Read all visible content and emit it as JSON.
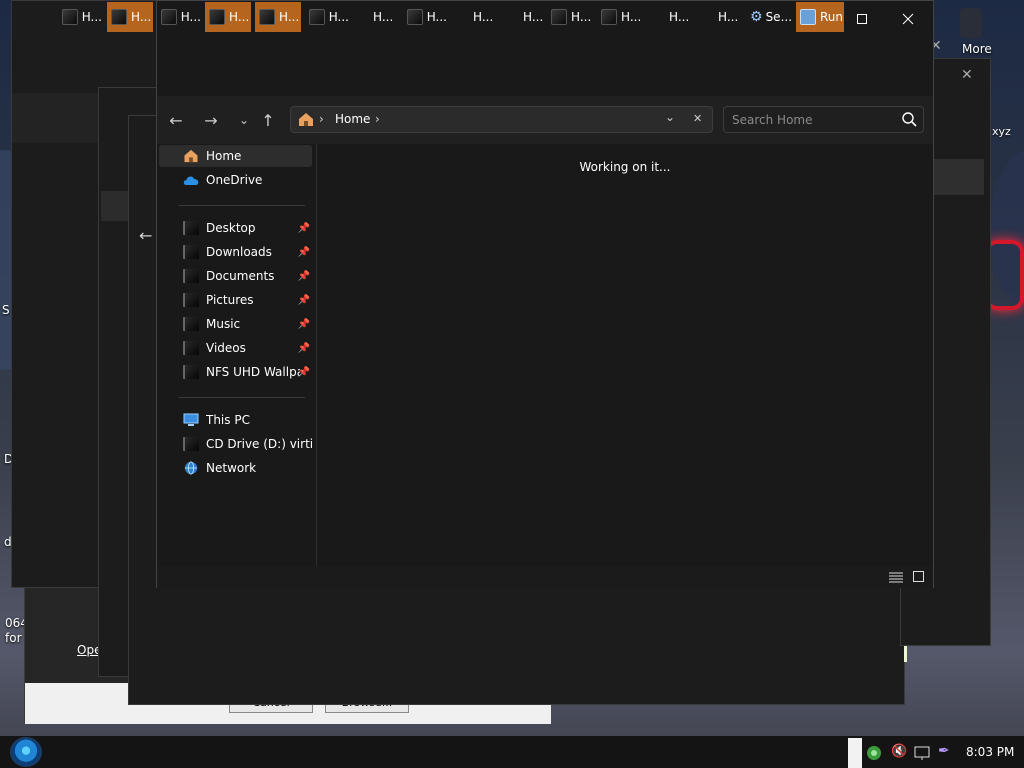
{
  "desktop": {
    "more_label": "More",
    "side_texts": [
      "S",
      "D",
      "d",
      "064",
      "for"
    ],
    "right_partial": "xyz",
    "partial_link": "Ope",
    "partial_button_1": "Cancel",
    "partial_button_2": "Browse..."
  },
  "explorer": {
    "address": {
      "home_label": "Home",
      "separator": "›",
      "trail": "›"
    },
    "search": {
      "placeholder": "Search Home"
    },
    "content": {
      "status_message": "Working on it..."
    },
    "sidebar": {
      "quick": [
        {
          "label": "Home",
          "selected": true
        },
        {
          "label": "OneDrive"
        }
      ],
      "pinned": [
        {
          "label": "Desktop"
        },
        {
          "label": "Downloads"
        },
        {
          "label": "Documents"
        },
        {
          "label": "Pictures"
        },
        {
          "label": "Music"
        },
        {
          "label": "Videos"
        },
        {
          "label": "NFS UHD Wallpap"
        }
      ],
      "devices": [
        {
          "label": "This PC"
        },
        {
          "label": "CD Drive (D:) virtio-w"
        },
        {
          "label": "Network"
        }
      ]
    }
  },
  "taskbar": {
    "items": [
      {
        "label": "H..."
      },
      {
        "label": "H...",
        "active": true
      },
      {
        "label": "H..."
      },
      {
        "label": "H...",
        "active": true
      },
      {
        "label": "H...",
        "active": true
      },
      {
        "label": "H..."
      },
      {
        "label": "H..."
      },
      {
        "label": "H..."
      },
      {
        "label": "H..."
      },
      {
        "label": "H..."
      },
      {
        "label": "H..."
      },
      {
        "label": "H..."
      },
      {
        "label": "H..."
      },
      {
        "label": "H..."
      },
      {
        "label": "H..."
      },
      {
        "label": "Se..."
      },
      {
        "label": "Run",
        "active": true
      }
    ],
    "clock": "8:03 PM"
  },
  "colors": {
    "accent": "#b5651d",
    "window_bg": "#191919",
    "onedrive": "#2b8fe4",
    "home_icon": "#e8a15e"
  }
}
